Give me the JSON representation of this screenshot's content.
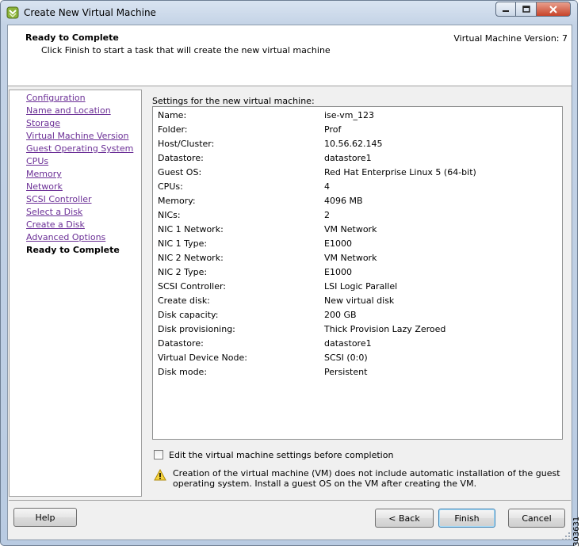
{
  "window": {
    "title": "Create New Virtual Machine",
    "controls": {
      "minimize": "–",
      "maximize": "□",
      "close": "✕"
    }
  },
  "header": {
    "title": "Ready to Complete",
    "subtitle": "Click Finish to start a task that will create the new virtual machine",
    "version": "Virtual Machine Version: 7"
  },
  "nav": {
    "items": [
      {
        "label": "Configuration",
        "current": false
      },
      {
        "label": "Name and Location",
        "current": false
      },
      {
        "label": "Storage",
        "current": false
      },
      {
        "label": "Virtual Machine Version",
        "current": false
      },
      {
        "label": "Guest Operating System",
        "current": false
      },
      {
        "label": "CPUs",
        "current": false
      },
      {
        "label": "Memory",
        "current": false
      },
      {
        "label": "Network",
        "current": false
      },
      {
        "label": "SCSI Controller",
        "current": false
      },
      {
        "label": "Select a Disk",
        "current": false
      },
      {
        "label": "Create a Disk",
        "current": false
      },
      {
        "label": "Advanced Options",
        "current": false
      },
      {
        "label": "Ready to Complete",
        "current": true
      }
    ]
  },
  "settings": {
    "label": "Settings for the new virtual machine:",
    "rows": [
      {
        "key": "Name:",
        "value": "ise-vm_123"
      },
      {
        "key": "Folder:",
        "value": "Prof"
      },
      {
        "key": "Host/Cluster:",
        "value": "10.56.62.145"
      },
      {
        "key": "Datastore:",
        "value": "datastore1"
      },
      {
        "key": "Guest OS:",
        "value": "Red Hat Enterprise Linux 5 (64-bit)"
      },
      {
        "key": "CPUs:",
        "value": "4"
      },
      {
        "key": "Memory:",
        "value": "4096 MB"
      },
      {
        "key": "NICs:",
        "value": "2"
      },
      {
        "key": "NIC 1 Network:",
        "value": "VM Network"
      },
      {
        "key": "NIC 1 Type:",
        "value": "E1000"
      },
      {
        "key": "NIC 2 Network:",
        "value": "VM Network"
      },
      {
        "key": "NIC 2 Type:",
        "value": "E1000"
      },
      {
        "key": "SCSI Controller:",
        "value": "LSI Logic Parallel"
      },
      {
        "key": "Create disk:",
        "value": "New virtual disk"
      },
      {
        "key": "Disk capacity:",
        "value": "200 GB"
      },
      {
        "key": "Disk provisioning:",
        "value": "Thick Provision Lazy Zeroed"
      },
      {
        "key": "Datastore:",
        "value": "datastore1"
      },
      {
        "key": "Virtual Device Node:",
        "value": "SCSI (0:0)"
      },
      {
        "key": "Disk mode:",
        "value": "Persistent"
      }
    ]
  },
  "edit_checkbox": {
    "label": "Edit the virtual machine settings before completion",
    "checked": false
  },
  "warning": {
    "icon": "warning-icon",
    "text": "Creation of the virtual machine (VM) does not include automatic installation of the guest operating system. Install a guest OS on the VM after creating the VM."
  },
  "buttons": {
    "help": "Help",
    "back": "< Back",
    "finish": "Finish",
    "cancel": "Cancel"
  },
  "figure_number": "303631"
}
